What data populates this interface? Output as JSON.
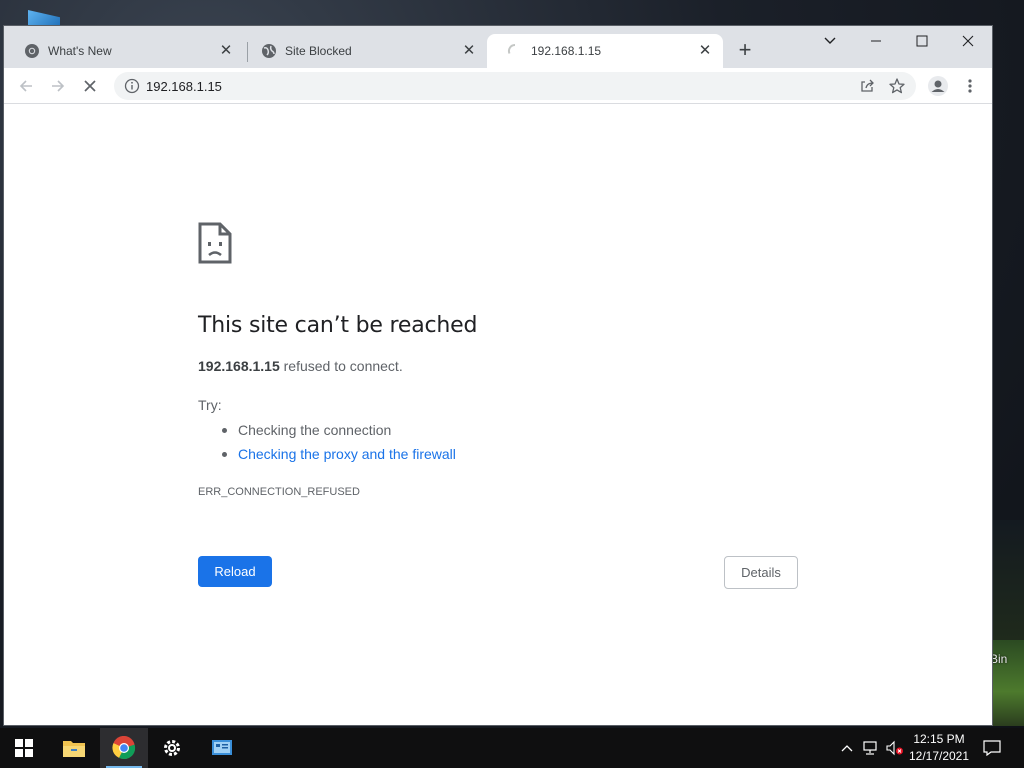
{
  "browser": {
    "tabs": [
      {
        "title": "What's New",
        "icon": "chrome-icon"
      },
      {
        "title": "Site Blocked",
        "icon": "globe-icon"
      },
      {
        "title": "192.168.1.15",
        "icon": "loading-spinner-icon",
        "active": true
      }
    ],
    "new_tab": "+",
    "address": "192.168.1.15"
  },
  "error_page": {
    "title": "This site can’t be reached",
    "host": "192.168.1.15",
    "message": " refused to connect.",
    "try_label": "Try:",
    "suggestions": [
      {
        "text": "Checking the connection",
        "link": false
      },
      {
        "text": "Checking the proxy and the firewall",
        "link": true
      }
    ],
    "error_code": "ERR_CONNECTION_REFUSED",
    "reload_label": "Reload",
    "details_label": "Details"
  },
  "desktop": {
    "recycle_bin_label": "Bin"
  },
  "taskbar": {
    "apps": [
      "windows-start-icon",
      "file-explorer-icon",
      "chrome-icon",
      "settings-gear-icon",
      "control-panel-icon"
    ],
    "time": "12:15 PM",
    "date": "12/17/2021"
  },
  "colors": {
    "accent": "#1a73e8",
    "tabstrip": "#dee1e6",
    "taskbar": "#0f0f10"
  }
}
